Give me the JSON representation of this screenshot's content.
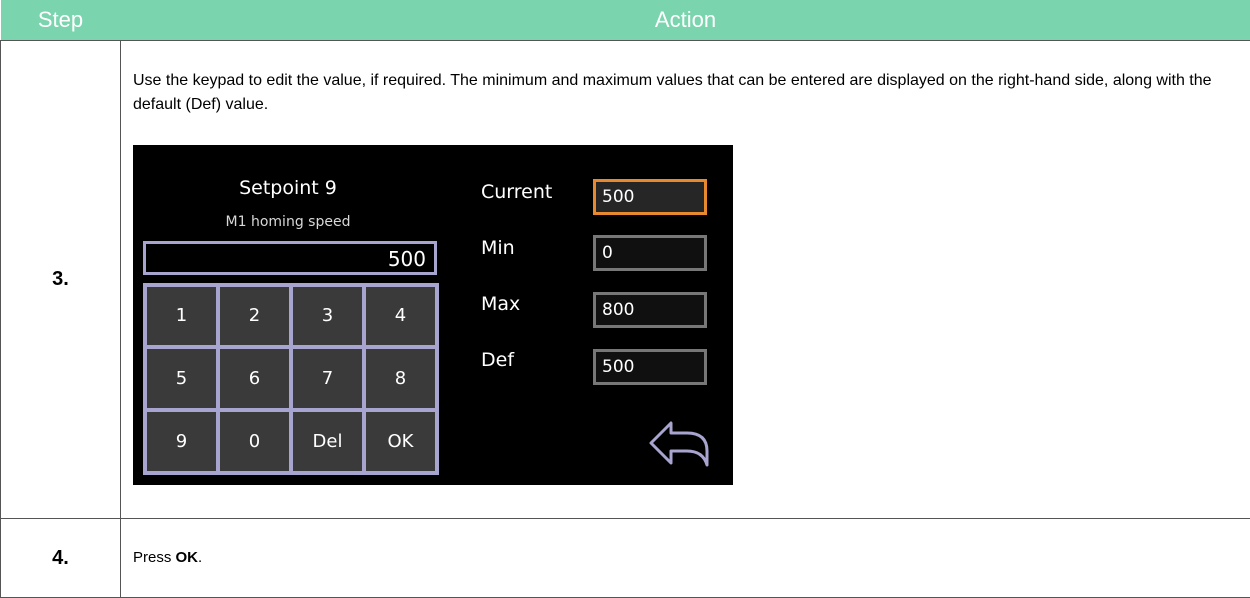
{
  "table": {
    "header": {
      "step": "Step",
      "action": "Action"
    },
    "rows": [
      {
        "step": "3.",
        "text": "Use the keypad to edit the value, if required. The minimum and maximum values that can be entered are displayed on the right-hand side, along with the default (Def) value."
      },
      {
        "step": "4.",
        "text_prefix": "Press ",
        "text_bold": "OK",
        "text_suffix": "."
      }
    ]
  },
  "screen": {
    "title": "Setpoint 9",
    "subtitle": "M1 homing speed",
    "entry_value": "500",
    "keys": [
      "1",
      "2",
      "3",
      "4",
      "5",
      "6",
      "7",
      "8",
      "9",
      "0",
      "Del",
      "OK"
    ],
    "fields": {
      "current": {
        "label": "Current",
        "value": "500"
      },
      "min": {
        "label": "Min",
        "value": "0"
      },
      "max": {
        "label": "Max",
        "value": "800"
      },
      "def": {
        "label": "Def",
        "value": "500"
      }
    },
    "back_icon": "back-arrow-icon",
    "colors": {
      "header_bg": "#7ad4ad",
      "screen_bg": "#000000",
      "keypad_border": "#a8a4d0",
      "active_field_border": "#e8892f"
    }
  }
}
